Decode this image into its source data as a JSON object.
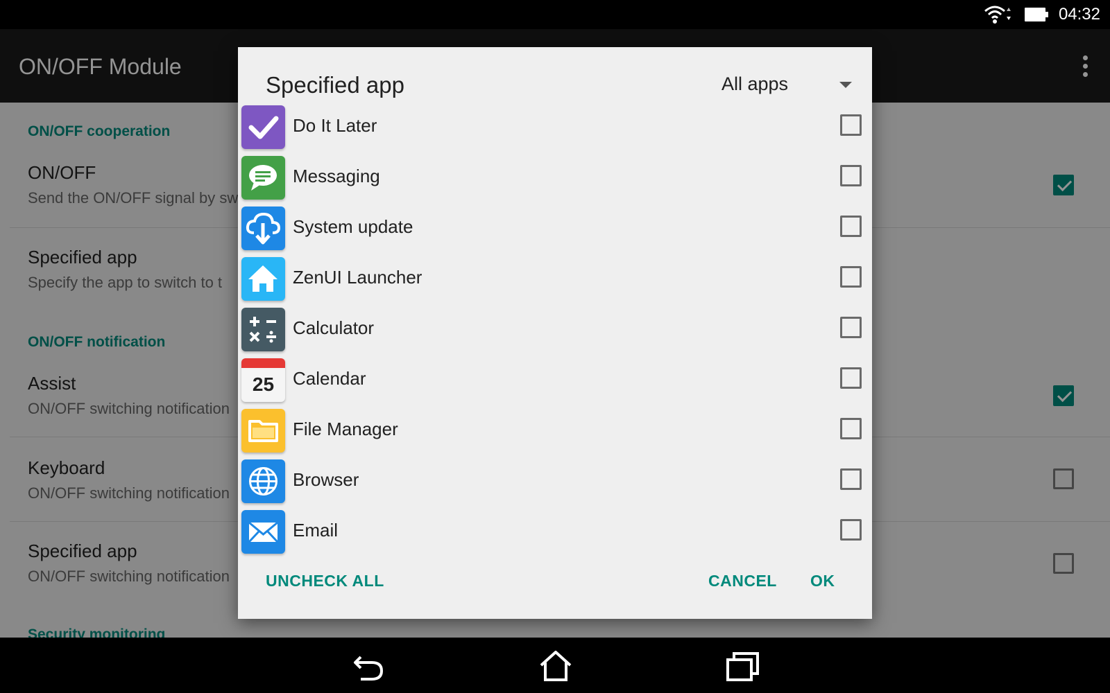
{
  "status_bar": {
    "time": "04:32"
  },
  "app_bar": {
    "title": "ON/OFF Module"
  },
  "settings": {
    "sections": [
      {
        "header": "ON/OFF cooperation"
      },
      {
        "header": "ON/OFF notification"
      },
      {
        "header": "Security monitoring"
      }
    ],
    "prefs": [
      {
        "title": "ON/OFF",
        "summary": "Send the ON/OFF signal by sw",
        "checked": true
      },
      {
        "title": "Specified app",
        "summary": "Specify the app to switch to t"
      },
      {
        "title": "Assist",
        "summary": "ON/OFF switching notification",
        "checked": true
      },
      {
        "title": "Keyboard",
        "summary": "ON/OFF switching notification",
        "checked": false
      },
      {
        "title": "Specified app",
        "summary": "ON/OFF switching notification",
        "checked": false
      }
    ]
  },
  "dialog": {
    "title": "Specified app",
    "filter": {
      "selected": "All apps"
    },
    "apps": [
      {
        "name": "Do It Later",
        "icon": "checkmark-icon",
        "color": "#7e57c2",
        "checked": false
      },
      {
        "name": "Messaging",
        "icon": "chat-bubble-icon",
        "color": "#43a047",
        "checked": false
      },
      {
        "name": "System update",
        "icon": "cloud-download-icon",
        "color": "#1e88e5",
        "checked": false
      },
      {
        "name": "ZenUI Launcher",
        "icon": "home-icon",
        "color": "#29b6f6",
        "checked": false
      },
      {
        "name": "Calculator",
        "icon": "calculator-icon",
        "color": "#455a64",
        "checked": false
      },
      {
        "name": "Calendar",
        "icon": "calendar-icon",
        "color": "#e53935",
        "day": "25",
        "checked": false
      },
      {
        "name": "File Manager",
        "icon": "folder-icon",
        "color": "#fbc02d",
        "checked": false
      },
      {
        "name": "Browser",
        "icon": "globe-icon",
        "color": "#1e88e5",
        "checked": false
      },
      {
        "name": "Email",
        "icon": "envelope-icon",
        "color": "#1e88e5",
        "checked": false
      }
    ],
    "actions": {
      "uncheck_all": "UNCHECK ALL",
      "cancel": "CANCEL",
      "ok": "OK"
    }
  },
  "colors": {
    "accent": "#00897b"
  }
}
